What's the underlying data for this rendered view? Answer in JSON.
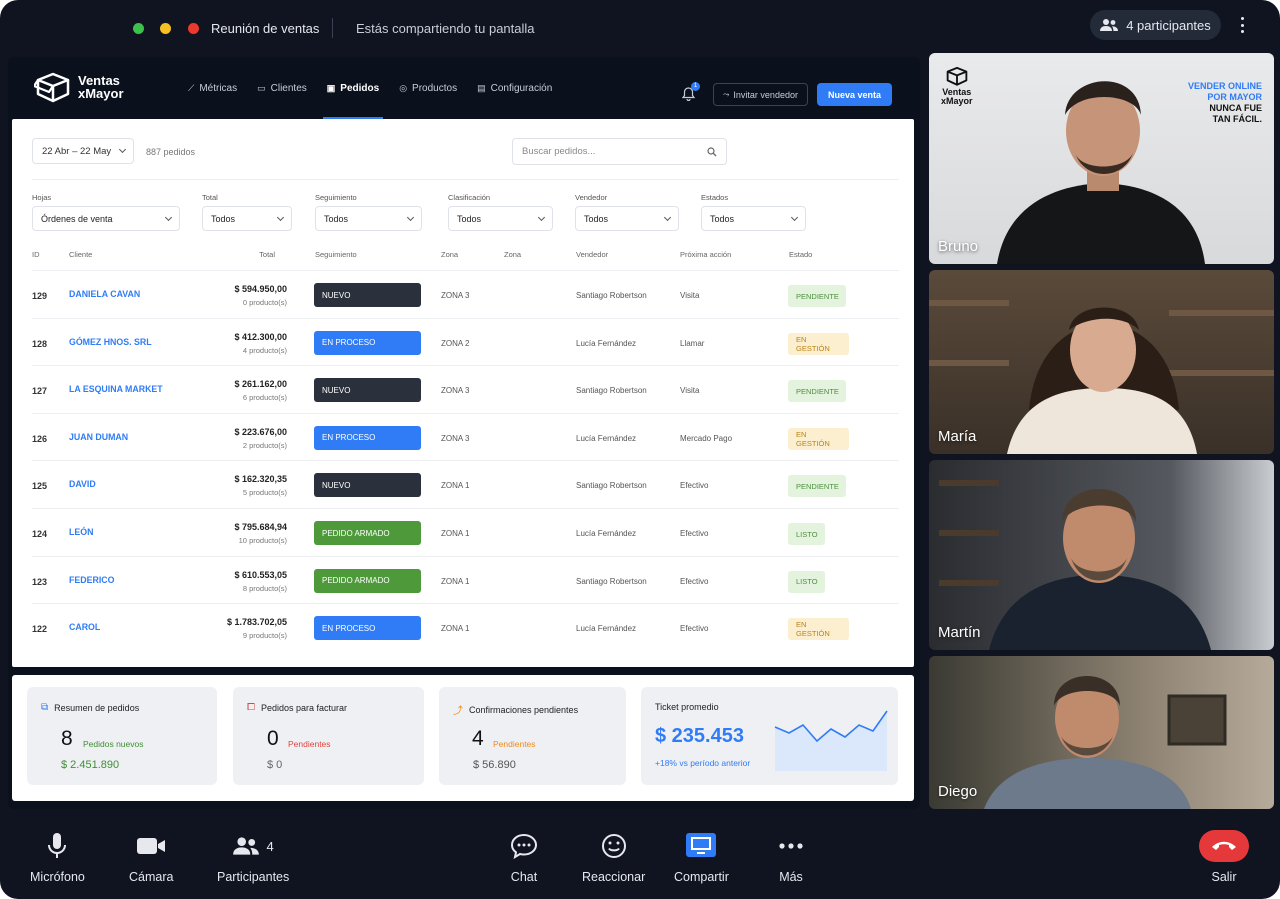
{
  "meeting": {
    "title": "Reunión de ventas",
    "sharing": "Estás compartiendo tu pantalla",
    "participants_label": "4 participantes",
    "window_dots": [
      "#3ac24a",
      "#f5c026",
      "#ea3a2e"
    ]
  },
  "app": {
    "logo": {
      "line1": "Ventas",
      "line2": "xMayor"
    },
    "nav": [
      {
        "label": "Métricas"
      },
      {
        "label": "Clientes"
      },
      {
        "label": "Pedidos"
      },
      {
        "label": "Productos"
      },
      {
        "label": "Configuración"
      }
    ],
    "notifications": "1",
    "invite_label": "Invitar vendedor",
    "new_sale_label": "Nueva venta",
    "date_range": "22 Abr – 22 May",
    "order_count": "887 pedidos",
    "search_placeholder": "Buscar pedidos...",
    "filters": [
      {
        "label": "Hojas",
        "value": "Órdenes de venta"
      },
      {
        "label": "Total",
        "value": "Todos"
      },
      {
        "label": "Seguimiento",
        "value": "Todos"
      },
      {
        "label": "Clasificación",
        "value": "Todos"
      },
      {
        "label": "Vendedor",
        "value": "Todos"
      },
      {
        "label": "Estados",
        "value": "Todos"
      }
    ],
    "columns": [
      "ID",
      "Cliente",
      "Total",
      "Seguimiento",
      "Zona",
      "Zona",
      "Vendedor",
      "Próxima acción",
      "Estado"
    ],
    "rows": [
      {
        "id": "129",
        "client": "DANIELA CAVAN",
        "total": "$ 594.950,00",
        "products": "0 producto(s)",
        "tracking": "NUEVO",
        "zone": "ZONA 3",
        "seller": "Santiago Robertson",
        "next": "Visita",
        "status": "PENDIENTE"
      },
      {
        "id": "128",
        "client": "GÓMEZ HNOS. SRL",
        "total": "$ 412.300,00",
        "products": "4 producto(s)",
        "tracking": "EN PROCESO",
        "zone": "ZONA 2",
        "seller": "Lucía Fernández",
        "next": "Llamar",
        "status": "EN GESTIÓN"
      },
      {
        "id": "127",
        "client": "LA ESQUINA MARKET",
        "total": "$ 261.162,00",
        "products": "6 producto(s)",
        "tracking": "NUEVO",
        "zone": "ZONA 3",
        "seller": "Santiago Robertson",
        "next": "Visita",
        "status": "PENDIENTE"
      },
      {
        "id": "126",
        "client": "JUAN DUMAN",
        "total": "$ 223.676,00",
        "products": "2 producto(s)",
        "tracking": "EN PROCESO",
        "zone": "ZONA 3",
        "seller": "Lucía Fernández",
        "next": "Mercado Pago",
        "status": "EN GESTIÓN"
      },
      {
        "id": "125",
        "client": "DAVID",
        "total": "$ 162.320,35",
        "products": "5 producto(s)",
        "tracking": "NUEVO",
        "zone": "ZONA 1",
        "seller": "Santiago Robertson",
        "next": "Efectivo",
        "status": "PENDIENTE"
      },
      {
        "id": "124",
        "client": "LEÓN",
        "total": "$ 795.684,94",
        "products": "10 producto(s)",
        "tracking": "PEDIDO ARMADO",
        "zone": "ZONA 1",
        "seller": "Lucía Fernández",
        "next": "Efectivo",
        "status": "LISTO"
      },
      {
        "id": "123",
        "client": "FEDERICO",
        "total": "$ 610.553,05",
        "products": "8 producto(s)",
        "tracking": "PEDIDO ARMADO",
        "zone": "ZONA 1",
        "seller": "Santiago Robertson",
        "next": "Efectivo",
        "status": "LISTO"
      },
      {
        "id": "122",
        "client": "CAROL",
        "total": "$ 1.783.702,05",
        "products": "9 producto(s)",
        "tracking": "EN PROCESO",
        "zone": "ZONA 1",
        "seller": "Lucía Fernández",
        "next": "Efectivo",
        "status": "EN GESTIÓN"
      }
    ],
    "summary": [
      {
        "title": "Resumen de pedidos",
        "count": "8",
        "tag": "Pedidos nuevos",
        "amount": "$ 2.451.890"
      },
      {
        "title": "Pedidos para facturar",
        "count": "0",
        "tag": "Pendientes",
        "amount": "$ 0"
      },
      {
        "title": "Confirmaciones pendientes",
        "count": "4",
        "tag": "Pendientes",
        "amount": "$ 56.890"
      },
      {
        "title": "Ticket promedio",
        "value": "$ 235.453",
        "delta": "+18% vs período anterior",
        "trend": [
          42,
          36,
          44,
          28,
          40,
          32,
          44,
          38,
          58
        ]
      }
    ],
    "colors": {
      "accent": "#2f7cf6",
      "nuevo": "#2b313c",
      "proceso": "#2f7cf6",
      "armado": "#4e9a3b"
    }
  },
  "participants": [
    {
      "name": "Bruno",
      "banner": [
        "VENDER ONLINE",
        "POR MAYOR",
        "NUNCA FUE",
        "TAN FÁCIL."
      ],
      "banner_logo": [
        "Ventas",
        "xMayor"
      ]
    },
    {
      "name": "María"
    },
    {
      "name": "Martín"
    },
    {
      "name": "Diego"
    }
  ],
  "controls": {
    "mic": "Micrófono",
    "camera": "Cámara",
    "participants": "Participantes",
    "participants_count": "4",
    "chat": "Chat",
    "react": "Reaccionar",
    "share": "Compartir",
    "more": "Más",
    "leave": "Salir"
  }
}
